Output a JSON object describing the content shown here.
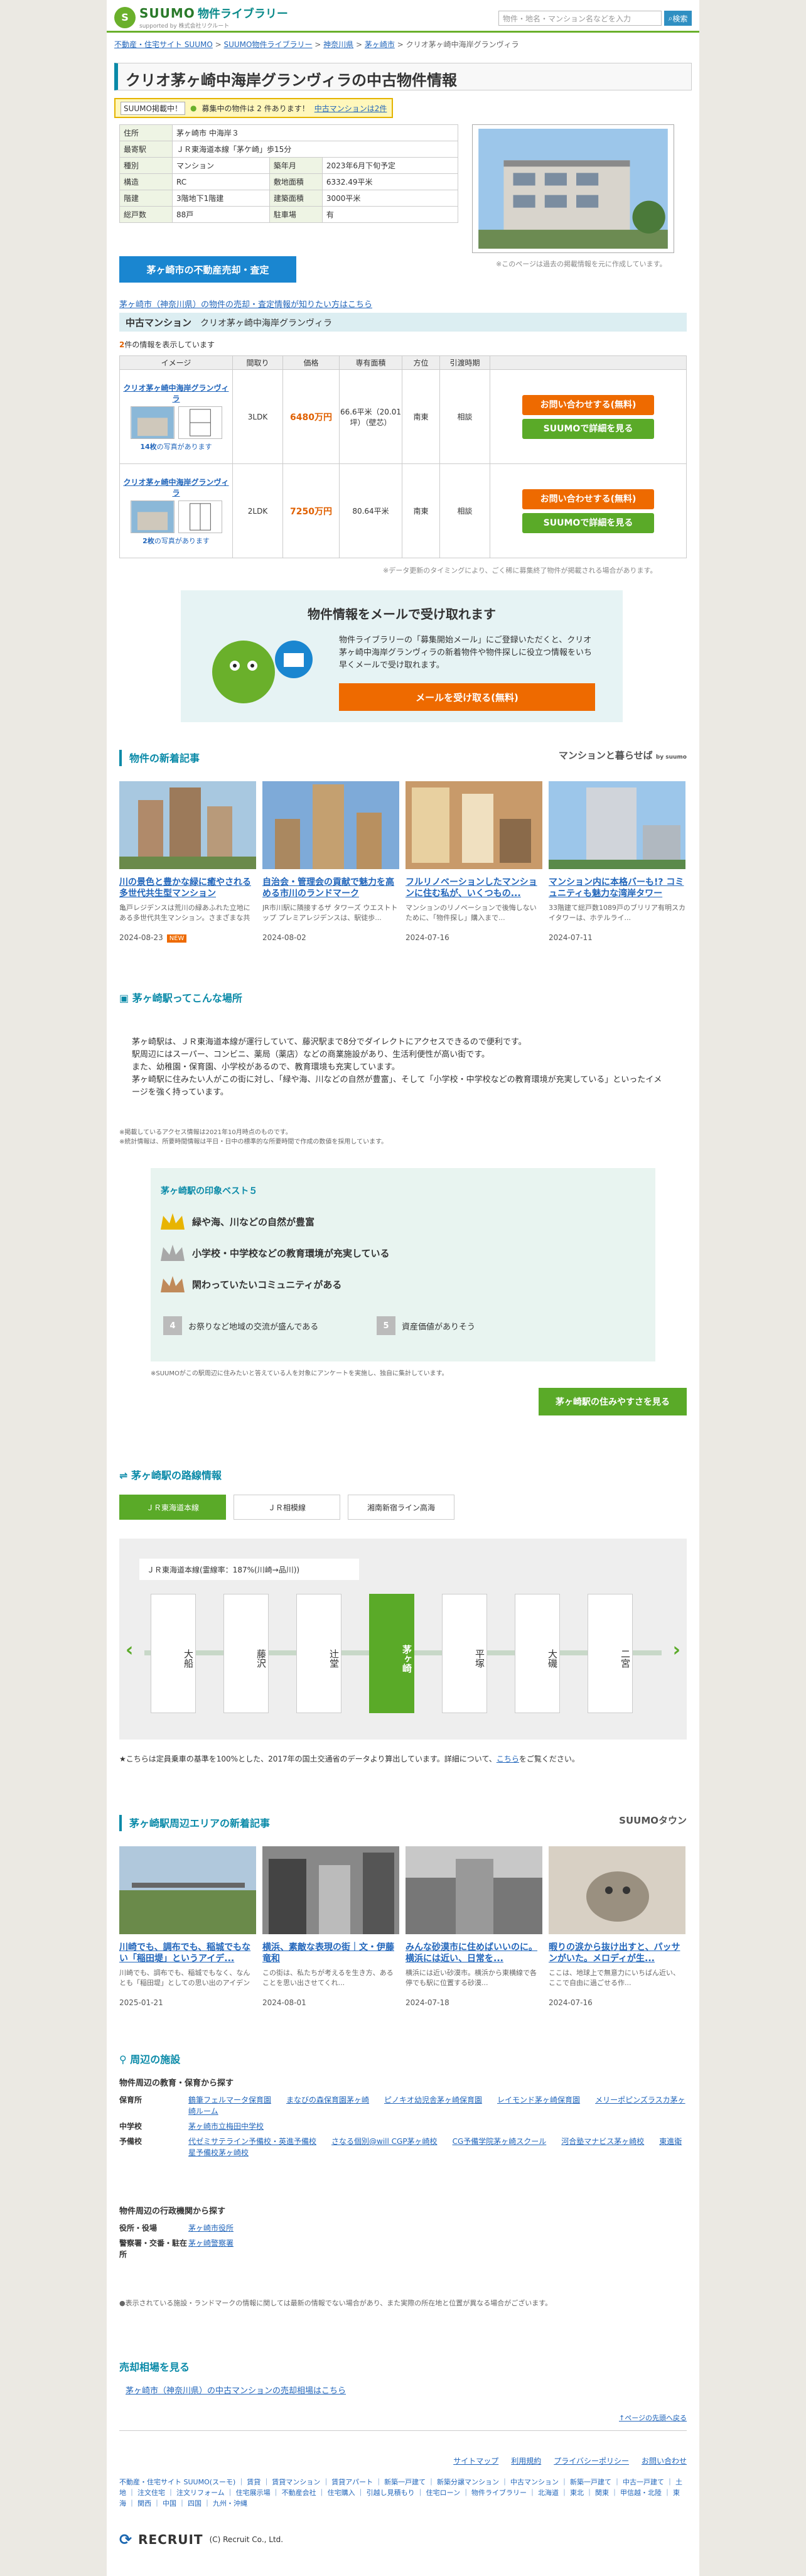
{
  "header": {
    "logo": "SUUMO",
    "logo_suffix": "物件ライブラリー",
    "logo_tagline": "supported by 株式会社リクルート",
    "search_placeholder": "物件・地名・マンション名などを入力",
    "search_button": "検索"
  },
  "breadcrumb": [
    "不動産・住宅サイト SUUMO",
    "SUUMO物件ライブラリー",
    "神奈川県",
    "茅ヶ崎市",
    "クリオ茅ヶ崎中海岸グランヴィラ"
  ],
  "title": "クリオ茅ヶ崎中海岸グランヴィラの中古物件情報",
  "badge": {
    "tag": "SUUMO掲載中！",
    "text": "募集中の物件は 2 件あります！",
    "link": "中古マンションは2件"
  },
  "info": [
    {
      "k": "住所",
      "v": "茅ヶ崎市 中海岸３"
    },
    {
      "k": "最寄駅",
      "v": "ＪＲ東海道本線「茅ケ崎」歩15分"
    },
    {
      "k": "種別",
      "v": "マンション",
      "k2": "築年月",
      "v2": "2023年6月下旬予定"
    },
    {
      "k": "構造",
      "v": "RC",
      "k2": "敷地面積",
      "v2": "6332.49平米"
    },
    {
      "k": "階建",
      "v": "3階地下1階建",
      "k2": "建築面積",
      "v2": "3000平米"
    },
    {
      "k": "総戸数",
      "v": "88戸",
      "k2": "駐車場",
      "v2": "有"
    }
  ],
  "photo_note": "※このページは過去の掲載情報を元に作成しています。",
  "sell_button": "茅ヶ崎市の不動産売却・査定",
  "area_link": "茅ヶ崎市（神奈川県）の物件の売却・査定情報が知りたい方はこちら",
  "listing": {
    "type": "中古マンション",
    "name": "クリオ茅ヶ崎中海岸グランヴィラ",
    "count_text": "件の情報を表示しています",
    "count": "2",
    "headers": [
      "イメージ",
      "間取り",
      "価格",
      "専有面積",
      "方位",
      "引渡時期",
      ""
    ],
    "rows": [
      {
        "name": "クリオ茅ヶ崎中海岸グランヴィラ",
        "photos": "14枚",
        "photos_suffix": "の写真があります",
        "layout": "3LDK",
        "price": "6480万円",
        "area": "66.6平米（20.01坪）（壁芯）",
        "dir": "南東",
        "delivery": "相談"
      },
      {
        "name": "クリオ茅ヶ崎中海岸グランヴィラ",
        "photos": "2枚",
        "photos_suffix": "の写真があります",
        "layout": "2LDK",
        "price": "7250万円",
        "area": "80.64平米",
        "dir": "南東",
        "delivery": "相談"
      }
    ],
    "btn_inquire": "お問い合わせする(無料)",
    "btn_detail": "SUUMOで詳細を見る",
    "note": "※データ更新のタイミングにより、ごく稀に募集終了物件が掲載される場合があります。"
  },
  "mail": {
    "title": "物件情報をメールで受け取れます",
    "text": "物件ライブラリーの「募集開始メール」にご登録いただくと、クリオ茅ヶ崎中海岸グランヴィラの新着物件や物件探しに役立つ情報をいち早くメールで受け取れます。",
    "button": "メールを受け取る(無料)"
  },
  "articles": {
    "title": "物件の新着記事",
    "brand": "マンションと暮らせば",
    "brand_by": "by suumo",
    "items": [
      {
        "t": "川の景色と豊かな緑に癒やされる多世代共生型マンション",
        "d": "亀戸レジデンスは荒川の緑あふれた立地にある多世代共生マンション。さまざまな共有施設と自...",
        "date": "2024-08-23",
        "new": "NEW"
      },
      {
        "t": "自治会・管理会の貢献で魅力を高める市川のランドマーク",
        "d": "JR市川駅に隣接するザ タワーズ ウエストトップ プレミアレジデンスは、駅徒歩...",
        "date": "2024-08-02"
      },
      {
        "t": "フルリノベーションしたマンションに住む私が、いくつもの...",
        "d": "マンションのリノベーションで後悔しないために、「物件探し」購入まで...",
        "date": "2024-07-16"
      },
      {
        "t": "マンション内に本格バーも!? コミュニティも魅力な湾岸タワー",
        "d": "33階建て総戸数1089戸のブリリア有明スカイタワーは、ホテルライ...",
        "date": "2024-07-11"
      }
    ]
  },
  "station": {
    "title": "茅ヶ崎駅ってこんな場所",
    "lines": [
      "茅ヶ崎駅は、ＪＲ東海道本線が運行していて、藤沢駅まで8分でダイレクトにアクセスできるので便利です。",
      "駅周辺にはスーパー、コンビニ、薬局（薬店）などの商業施設があり、生活利便性が高い街です。",
      "また、幼稚園・保育園、小学校があるので、教育環境も充実しています。",
      "茅ヶ崎駅に住みたい人がこの街に対し、「緑や海、川などの自然が豊富」、そして「小学校・中学校などの教育環境が充実している」といったイメージを強く持っています。"
    ],
    "notes": [
      "※掲載しているアクセス情報は2021年10月時点のものです。",
      "※統計情報は、所要時間情報は平日・日中の標準的な所要時間で作成の数値を採用しています。"
    ],
    "best_title": "茅ヶ崎駅の印象ベスト５",
    "best": [
      "緑や海、川などの自然が豊富",
      "小学校・中学校などの教育環境が充実している",
      "閑わっていたいコミュニティがある"
    ],
    "best_more": [
      {
        "n": "4",
        "t": "お祭りなど地域の交流が盛んである"
      },
      {
        "n": "5",
        "t": "資産価値がありそう"
      }
    ],
    "best_note": "※SUUMOがこの駅周辺に住みたいと答えている人を対象にアンケートを実施し、独自に集計しています。",
    "button": "茅ヶ崎駅の住みやすさを見る"
  },
  "rail": {
    "title": "茅ヶ崎駅の路線情報",
    "tabs": [
      "ＪＲ東海道本線",
      "ＪＲ相模線",
      "湘南新宿ライン高海"
    ],
    "line_label": "ＪＲ東海道本線(霊線率：187%(川崎→品川))",
    "stations": [
      "大船",
      "藤沢",
      "辻堂",
      "茅ヶ崎",
      "平塚",
      "大磯",
      "二宮"
    ],
    "current": "茅ヶ崎",
    "note": "★こちらは定員乗車の基準を100%とした、2017年の国土交通省のデータより算出しています。詳細について、",
    "note_link": "こちら",
    "note_end": "をご覧ください。"
  },
  "area_articles": {
    "title": "茅ヶ崎駅周辺エリアの新着記事",
    "brand": "SUUMOタウン",
    "items": [
      {
        "t": "川崎でも、調布でも、稲城でもない「稲田堤」というアイデ...",
        "d": "川崎でも、調布でも、稲城でもなく、なんとも「稲田堤」としての思い出のアイデンティティ...",
        "date": "2025-01-21"
      },
      {
        "t": "横浜、素敵な表現の街｜文・伊藤竜和",
        "d": "この街は、私たちが考えるを生き方、あることを思い出させてくれ...",
        "date": "2024-08-01"
      },
      {
        "t": "みんな砂漠市に住めばいいのに。横浜には近い、日常を...",
        "d": "横浜には近い砂漠市。横浜から東横線で各停でも駅に位置する砂漠...",
        "date": "2024-07-18"
      },
      {
        "t": "暇りの涙から抜け出すと、パッサンがいた。メロディが生...",
        "d": "ここは、地球上で無意力にいちばん近い、ここで自由に過ごせる作...",
        "date": "2024-07-16"
      }
    ]
  },
  "facilities": {
    "title": "周辺の施設",
    "edu_title": "物件周辺の教育・保育から探す",
    "edu": [
      {
        "k": "保育所",
        "v": [
          "鶴筆フェルマータ保育園",
          "まなびの森保育園茅ヶ崎",
          "ピノキオ幼児舎茅ヶ崎保育園",
          "レイモンド茅ヶ崎保育園",
          "メリーポピンズラスカ茅ヶ崎ルーム"
        ]
      },
      {
        "k": "中学校",
        "v": [
          "茅ヶ崎市立梅田中学校"
        ]
      },
      {
        "k": "予備校",
        "v": [
          "代ゼミサテライン予備校・英進予備校",
          "さなる個別@will CGP茅ヶ崎校",
          "CG予備学院茅ヶ崎スクール",
          "河合塾マナビス茅ヶ崎校",
          "東進衛星予備校茅ヶ崎校"
        ]
      }
    ],
    "admin_title": "物件周辺の行政機関から探す",
    "admin": [
      {
        "k": "役所・役場",
        "v": [
          "茅ヶ崎市役所"
        ]
      },
      {
        "k": "警察署・交番・駐在所",
        "v": [
          "茅ヶ崎警察署"
        ]
      }
    ],
    "note": "●表示されている施設・ランドマークの情報に関しては最新の情報でない場合があり、また実際の所在地と位置が異なる場合がございます。"
  },
  "price": {
    "title": "売却相場を見る",
    "link": "茅ヶ崎市（神奈川県）の中古マンションの売却相場はこちら"
  },
  "to_top": "↑ページの先頭へ戻る",
  "footer_links": [
    "サイトマップ",
    "利用規約",
    "プライバシーポリシー",
    "お問い合わせ"
  ],
  "footer_text": "不動産・住宅サイト SUUMO(スーモ) ｜ 賃貸 ｜ 賃貸マンション ｜ 賃貸アパート ｜ 新築一戸建て ｜ 新築分譲マンション ｜ 中古マンション ｜ 新築一戸建て ｜ 中古一戸建て ｜ 土地 ｜ 注文住宅 ｜ 注文リフォーム ｜ 住宅展示場 ｜ 不動産会社 ｜ 住宅購入 ｜ 引越し見積もり ｜ 住宅ローン ｜ 物件ライブラリー ｜ 北海道 ｜ 東北 ｜ 関東 ｜ 甲信越・北陸 ｜ 東海 ｜ 関西 ｜ 中国 ｜ 四国 ｜ 九州・沖縄",
  "copyright": "(C) Recruit Co., Ltd.",
  "recruit": "RECRUIT"
}
